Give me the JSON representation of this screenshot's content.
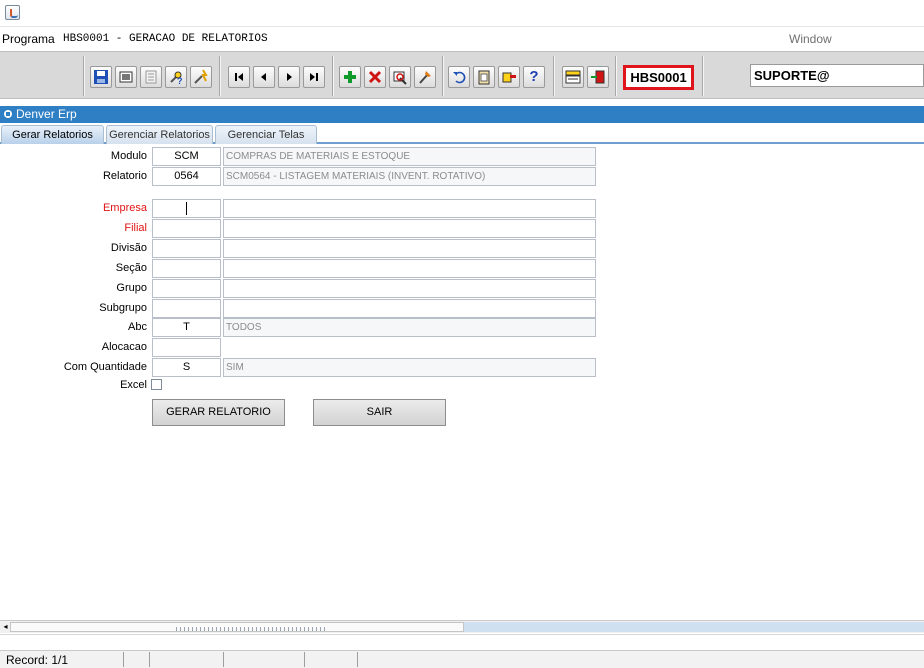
{
  "titlebar": {
    "icon": "java-app-icon"
  },
  "menubar": {
    "programa": "Programa",
    "title": "HBS0001 - GERACAO DE RELATORIOS",
    "window": "Window"
  },
  "toolbar": {
    "groups": [
      [
        "save-icon",
        "window-icon",
        "print-icon",
        "query-icon",
        "execute-query-icon"
      ],
      [
        "first-record-icon",
        "previous-record-icon",
        "next-record-icon",
        "last-record-icon"
      ],
      [
        "insert-record-icon",
        "delete-record-icon",
        "commit-icon",
        "clear-icon"
      ],
      [
        "undo-icon",
        "clipboard-icon",
        "hand-pointer-icon",
        "help-icon"
      ],
      [
        "menu-icon",
        "exit-icon"
      ]
    ],
    "help_glyph": "?",
    "program_code": "HBS0001",
    "user": "SUPORTE@"
  },
  "window": {
    "title": "Denver Erp"
  },
  "tabs": [
    {
      "label": "Gerar Relatorios",
      "active": true
    },
    {
      "label": "Gerenciar Relatorios",
      "active": false
    },
    {
      "label": "Gerenciar Telas",
      "active": false
    }
  ],
  "form": {
    "modulo": {
      "label": "Modulo",
      "code": "SCM",
      "desc": "COMPRAS DE MATERIAIS E ESTOQUE"
    },
    "relatorio": {
      "label": "Relatorio",
      "code": "0564",
      "desc": "SCM0564 - LISTAGEM MATERIAIS (INVENT. ROTATIVO)"
    },
    "empresa": {
      "label": "Empresa",
      "code": "",
      "desc": ""
    },
    "filial": {
      "label": "Filial",
      "code": "",
      "desc": ""
    },
    "divisao": {
      "label": "Divisão",
      "code": "",
      "desc": ""
    },
    "secao": {
      "label": "Seção",
      "code": "",
      "desc": ""
    },
    "grupo": {
      "label": "Grupo",
      "code": "",
      "desc": ""
    },
    "subgrupo": {
      "label": "Subgrupo",
      "code": "",
      "desc": ""
    },
    "abc": {
      "label": "Abc",
      "code": "T",
      "desc": "TODOS"
    },
    "alocacao": {
      "label": "Alocacao",
      "code": ""
    },
    "com_quantidade": {
      "label": "Com Quantidade",
      "code": "S",
      "desc": "SIM"
    },
    "excel": {
      "label": "Excel",
      "checked": false
    },
    "required_color": "#e01414"
  },
  "buttons": {
    "gerar": "GERAR RELATORIO",
    "sair": "SAIR"
  },
  "status": {
    "record": "Record: 1/1"
  },
  "colors": {
    "window_header": "#2e7fc4",
    "toolbar": "#d9d9d9",
    "highlight_border": "#e0141b"
  }
}
